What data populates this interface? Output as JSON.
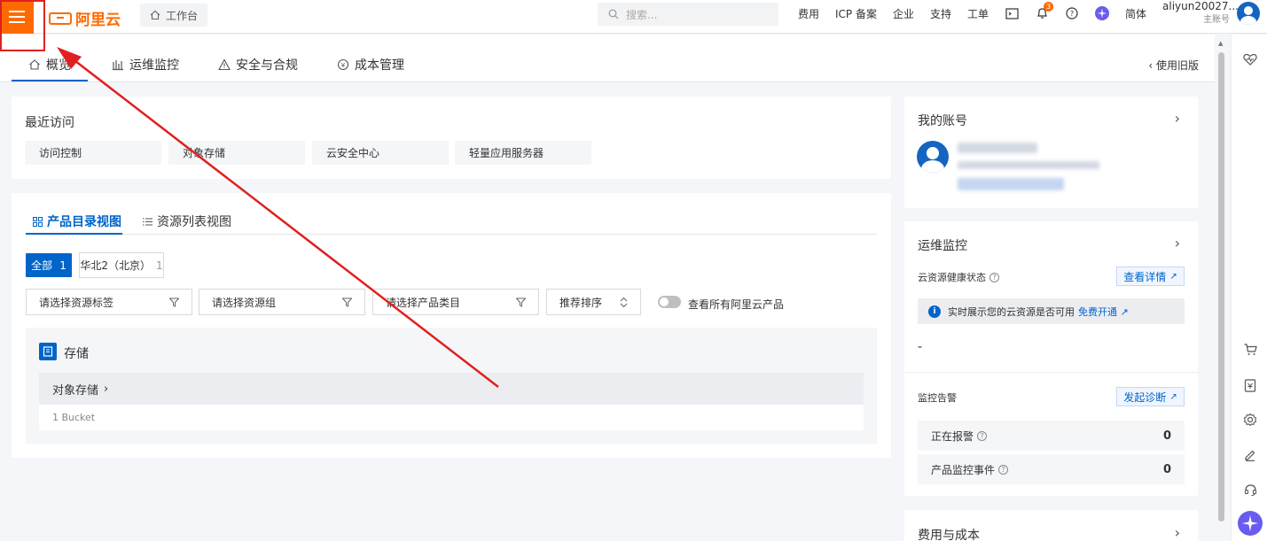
{
  "topbar": {
    "logo_text": "阿里云",
    "workbench_label": "工作台",
    "search_placeholder": "搜索...",
    "links": [
      "费用",
      "ICP 备案",
      "企业",
      "支持",
      "工单"
    ],
    "notification_count": "3",
    "lang_label": "简体",
    "account_name": "aliyun20027...",
    "account_role": "主账号",
    "brand_color": "#ff6a00"
  },
  "tabs": {
    "items": [
      {
        "label": "概览",
        "icon": "home-icon"
      },
      {
        "label": "运维监控",
        "icon": "bar-chart-icon"
      },
      {
        "label": "安全与合规",
        "icon": "warning-icon"
      },
      {
        "label": "成本管理",
        "icon": "cost-icon"
      }
    ],
    "old_version_label": "使用旧版",
    "active_index": 0
  },
  "recent": {
    "title": "最近访问",
    "items": [
      "访问控制",
      "对象存储",
      "云安全中心",
      "轻量应用服务器"
    ]
  },
  "catalog": {
    "view_tabs": [
      "产品目录视图",
      "资源列表视图"
    ],
    "region_all": "全部",
    "region_all_count": "1",
    "region_name": "华北2（北京）",
    "region_count": "1",
    "filters": [
      "请选择资源标签",
      "请选择资源组",
      "请选择产品类目"
    ],
    "sort_label": "推荐排序",
    "toggle_label": "查看所有阿里云产品",
    "section_title": "存储",
    "product_name": "对象存储",
    "product_detail": "1 Bucket"
  },
  "account_card": {
    "title": "我的账号"
  },
  "monitor_card": {
    "title": "运维监控",
    "health_label": "云资源健康状态",
    "detail_btn": "查看详情",
    "notice_text": "实时展示您的云资源是否可用",
    "notice_link": "免费开通",
    "dash_value": "-",
    "alarm_label": "监控告警",
    "diagnose_btn": "发起诊断",
    "alarming_label": "正在报警",
    "alarming_value": "0",
    "events_label": "产品监控事件",
    "events_value": "0"
  },
  "cost_card": {
    "title": "费用与成本"
  },
  "accent_color": "#0064c8"
}
